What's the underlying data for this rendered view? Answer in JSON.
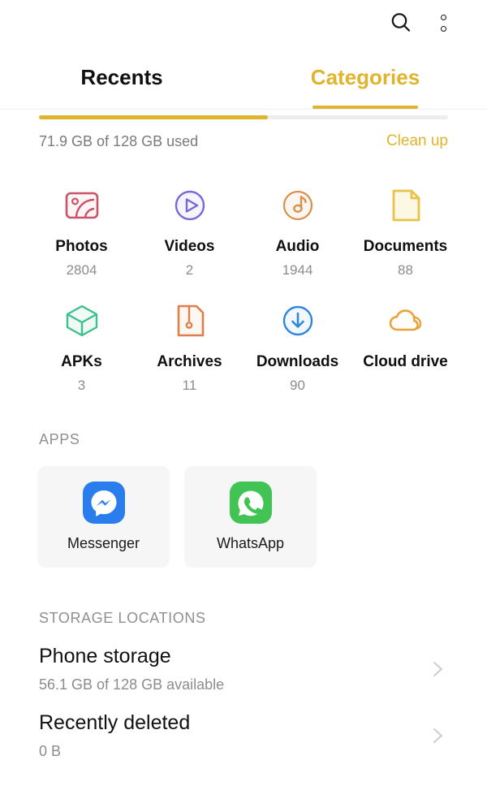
{
  "topbar": {
    "search_icon": "search-icon",
    "overflow_icon": "more-options-icon"
  },
  "tabs": [
    {
      "label": "Recents",
      "active": false
    },
    {
      "label": "Categories",
      "active": true
    }
  ],
  "storage_summary": {
    "used_text": "71.9 GB of 128 GB used",
    "cleanup_label": "Clean up",
    "progress_percent": 56,
    "accent_color": "#e0b42c",
    "track_color": "#ededed"
  },
  "categories": [
    {
      "label": "Photos",
      "count": "2804",
      "icon": "photos-icon",
      "color": "#c8546a"
    },
    {
      "label": "Videos",
      "count": "2",
      "icon": "videos-icon",
      "color": "#7b68d4"
    },
    {
      "label": "Audio",
      "count": "1944",
      "icon": "audio-icon",
      "color": "#d9904e"
    },
    {
      "label": "Documents",
      "count": "88",
      "icon": "documents-icon",
      "color": "#e8c34a"
    },
    {
      "label": "APKs",
      "count": "3",
      "icon": "apks-icon",
      "color": "#3fbf8f"
    },
    {
      "label": "Archives",
      "count": "11",
      "icon": "archives-icon",
      "color": "#dd7f4a"
    },
    {
      "label": "Downloads",
      "count": "90",
      "icon": "downloads-icon",
      "color": "#2e86de"
    },
    {
      "label": "Cloud drive",
      "count": "",
      "icon": "cloud-drive-icon",
      "color": "#e8a33d"
    }
  ],
  "apps_section": {
    "title": "APPS",
    "apps": [
      {
        "name": "Messenger",
        "icon": "messenger-icon",
        "color": "#2a7ded"
      },
      {
        "name": "WhatsApp",
        "icon": "whatsapp-icon",
        "color": "#41c453"
      }
    ]
  },
  "locations_section": {
    "title": "STORAGE LOCATIONS",
    "locations": [
      {
        "title": "Phone storage",
        "subtitle": "56.1 GB of 128 GB available"
      },
      {
        "title": "Recently deleted",
        "subtitle": "0 B"
      }
    ]
  }
}
